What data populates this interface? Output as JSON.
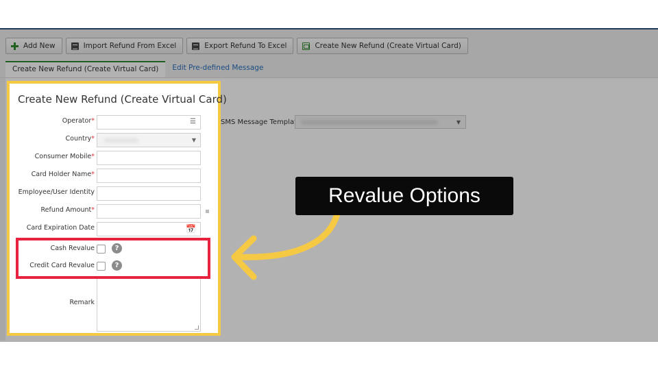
{
  "toolbar": {
    "buttons": [
      {
        "label": "Add New",
        "icon": "plus-icon"
      },
      {
        "label": "Import Refund From Excel",
        "icon": "excel-file-icon"
      },
      {
        "label": "Export Refund To Excel",
        "icon": "excel-file-icon"
      },
      {
        "label": "Create New Refund (Create Virtual Card)",
        "icon": "card-icon"
      }
    ]
  },
  "tabs": [
    {
      "label": "Create New Refund (Create Virtual Card)",
      "active": true
    },
    {
      "label": "Edit Pre-defined Message",
      "active": false
    }
  ],
  "form": {
    "title": "Create New Refund (Create Virtual Card)",
    "fields": {
      "operator": {
        "label": "Operator",
        "required": "*"
      },
      "country": {
        "label": "Country",
        "required": "*"
      },
      "consumer_mobile": {
        "label": "Consumer Mobile",
        "required": "*"
      },
      "card_holder_name": {
        "label": "Card Holder Name",
        "required": "*"
      },
      "employee_identity": {
        "label": "Employee/User Identity"
      },
      "refund_amount": {
        "label": "Refund Amount",
        "required": "*"
      },
      "card_expiration": {
        "label": "Card Expiration Date"
      },
      "cash_revalue": {
        "label": "Cash Revalue",
        "help": "?"
      },
      "credit_card_revalue": {
        "label": "Credit Card Revalue",
        "help": "?"
      },
      "remark": {
        "label": "Remark"
      }
    },
    "sms_template_label": "SMS Message Template"
  },
  "callout": {
    "text": "Revalue Options"
  },
  "colors": {
    "highlight_yellow": "#f6c945",
    "highlight_red": "#e8233f",
    "header_navy": "#1e3b5c",
    "accent_green": "#2e8b2e",
    "link_blue": "#2a6ebb"
  }
}
